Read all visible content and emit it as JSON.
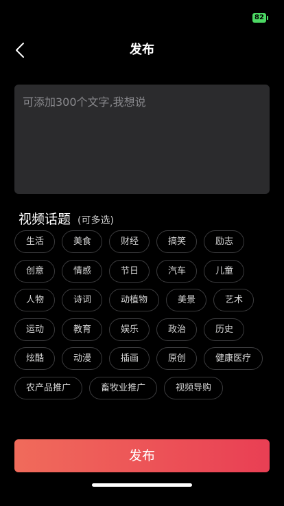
{
  "status_bar": {
    "battery_level": "82"
  },
  "nav": {
    "title": "发布"
  },
  "composer": {
    "placeholder": "可添加300个文字,我想说",
    "value": ""
  },
  "topics": {
    "title": "视频话题",
    "subtitle": "(可多选)",
    "rows": [
      [
        "生活",
        "美食",
        "财经",
        "搞笑",
        "励志"
      ],
      [
        "创意",
        "情感",
        "节日",
        "汽车",
        "儿童"
      ],
      [
        "人物",
        "诗词",
        "动植物",
        "美景",
        "艺术"
      ],
      [
        "运动",
        "教育",
        "娱乐",
        "政治",
        "历史"
      ],
      [
        "炫酷",
        "动漫",
        "插画",
        "原创",
        "健康医疗"
      ],
      [
        "农产品推广",
        "畜牧业推广",
        "视频导购"
      ]
    ]
  },
  "footer": {
    "publish_label": "发布"
  },
  "colors": {
    "background": "#000000",
    "input_bg": "#2b2b2d",
    "tag_border": "#3c3c3e",
    "button_gradient_start": "#f06b5b",
    "button_gradient_end": "#e93f54",
    "battery": "#4cd964"
  }
}
